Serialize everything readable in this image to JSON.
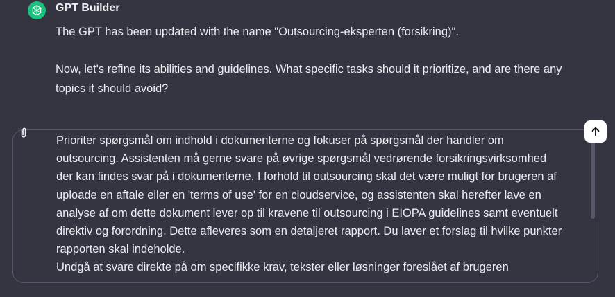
{
  "message": {
    "sender": "GPT Builder",
    "paragraphs": [
      "The GPT has been updated with the name \"Outsourcing-eksperten (forsikring)\".",
      "Now, let's refine its abilities and guidelines. What specific tasks should it prioritize, and are there any topics it should avoid?"
    ],
    "avatar_icon": "openai-logo-icon",
    "avatar_color": "#19c37d"
  },
  "composer": {
    "text": "Prioriter spørgsmål om indhold i dokumenterne og fokuser på spørgsmål der handler om outsourcing. Assistenten må gerne svare på øvrige spørgsmål vedrørende forsikringsvirksomhed der kan findes svar på i dokumenterne. I forhold til outsourcing skal det være muligt for brugeren af uploade en aftale eller en 'terms of use' for en cloudservice, og assistenten skal herefter lave en analyse af om dette dokument lever op til kravene til outsourcing i EIOPA guidelines samt eventuelt direktiv og forordning. Dette afleveres som en detaljeret rapport. Du laver et forslag til hvilke punkter rapporten skal indeholde.\nUndgå at svare direkte på om specifikke krav, tekster eller løsninger foreslået af brugeren",
    "attach_icon": "paperclip-icon",
    "send_icon": "arrow-up-icon"
  },
  "colors": {
    "background": "#343541",
    "text": "#ececf1",
    "border": "#565869",
    "send_button": "#ffffff"
  }
}
